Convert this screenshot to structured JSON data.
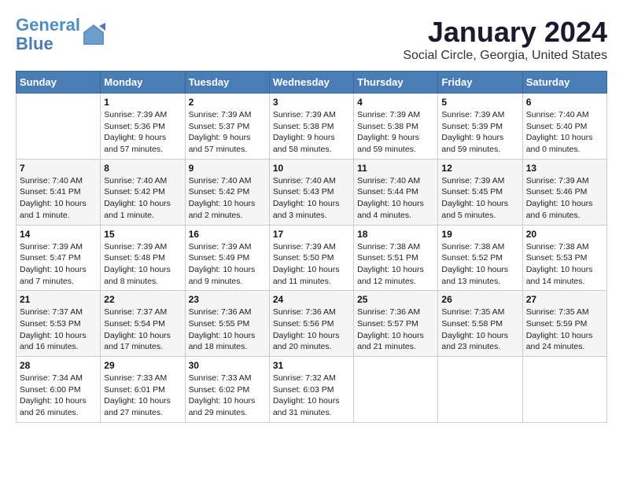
{
  "header": {
    "logo_line1": "General",
    "logo_line2": "Blue",
    "month_title": "January 2024",
    "location": "Social Circle, Georgia, United States"
  },
  "weekdays": [
    "Sunday",
    "Monday",
    "Tuesday",
    "Wednesday",
    "Thursday",
    "Friday",
    "Saturday"
  ],
  "weeks": [
    [
      {
        "day": "",
        "info": ""
      },
      {
        "day": "1",
        "info": "Sunrise: 7:39 AM\nSunset: 5:36 PM\nDaylight: 9 hours\nand 57 minutes."
      },
      {
        "day": "2",
        "info": "Sunrise: 7:39 AM\nSunset: 5:37 PM\nDaylight: 9 hours\nand 57 minutes."
      },
      {
        "day": "3",
        "info": "Sunrise: 7:39 AM\nSunset: 5:38 PM\nDaylight: 9 hours\nand 58 minutes."
      },
      {
        "day": "4",
        "info": "Sunrise: 7:39 AM\nSunset: 5:38 PM\nDaylight: 9 hours\nand 59 minutes."
      },
      {
        "day": "5",
        "info": "Sunrise: 7:39 AM\nSunset: 5:39 PM\nDaylight: 9 hours\nand 59 minutes."
      },
      {
        "day": "6",
        "info": "Sunrise: 7:40 AM\nSunset: 5:40 PM\nDaylight: 10 hours\nand 0 minutes."
      }
    ],
    [
      {
        "day": "7",
        "info": "Sunrise: 7:40 AM\nSunset: 5:41 PM\nDaylight: 10 hours\nand 1 minute."
      },
      {
        "day": "8",
        "info": "Sunrise: 7:40 AM\nSunset: 5:42 PM\nDaylight: 10 hours\nand 1 minute."
      },
      {
        "day": "9",
        "info": "Sunrise: 7:40 AM\nSunset: 5:42 PM\nDaylight: 10 hours\nand 2 minutes."
      },
      {
        "day": "10",
        "info": "Sunrise: 7:40 AM\nSunset: 5:43 PM\nDaylight: 10 hours\nand 3 minutes."
      },
      {
        "day": "11",
        "info": "Sunrise: 7:40 AM\nSunset: 5:44 PM\nDaylight: 10 hours\nand 4 minutes."
      },
      {
        "day": "12",
        "info": "Sunrise: 7:39 AM\nSunset: 5:45 PM\nDaylight: 10 hours\nand 5 minutes."
      },
      {
        "day": "13",
        "info": "Sunrise: 7:39 AM\nSunset: 5:46 PM\nDaylight: 10 hours\nand 6 minutes."
      }
    ],
    [
      {
        "day": "14",
        "info": "Sunrise: 7:39 AM\nSunset: 5:47 PM\nDaylight: 10 hours\nand 7 minutes."
      },
      {
        "day": "15",
        "info": "Sunrise: 7:39 AM\nSunset: 5:48 PM\nDaylight: 10 hours\nand 8 minutes."
      },
      {
        "day": "16",
        "info": "Sunrise: 7:39 AM\nSunset: 5:49 PM\nDaylight: 10 hours\nand 9 minutes."
      },
      {
        "day": "17",
        "info": "Sunrise: 7:39 AM\nSunset: 5:50 PM\nDaylight: 10 hours\nand 11 minutes."
      },
      {
        "day": "18",
        "info": "Sunrise: 7:38 AM\nSunset: 5:51 PM\nDaylight: 10 hours\nand 12 minutes."
      },
      {
        "day": "19",
        "info": "Sunrise: 7:38 AM\nSunset: 5:52 PM\nDaylight: 10 hours\nand 13 minutes."
      },
      {
        "day": "20",
        "info": "Sunrise: 7:38 AM\nSunset: 5:53 PM\nDaylight: 10 hours\nand 14 minutes."
      }
    ],
    [
      {
        "day": "21",
        "info": "Sunrise: 7:37 AM\nSunset: 5:53 PM\nDaylight: 10 hours\nand 16 minutes."
      },
      {
        "day": "22",
        "info": "Sunrise: 7:37 AM\nSunset: 5:54 PM\nDaylight: 10 hours\nand 17 minutes."
      },
      {
        "day": "23",
        "info": "Sunrise: 7:36 AM\nSunset: 5:55 PM\nDaylight: 10 hours\nand 18 minutes."
      },
      {
        "day": "24",
        "info": "Sunrise: 7:36 AM\nSunset: 5:56 PM\nDaylight: 10 hours\nand 20 minutes."
      },
      {
        "day": "25",
        "info": "Sunrise: 7:36 AM\nSunset: 5:57 PM\nDaylight: 10 hours\nand 21 minutes."
      },
      {
        "day": "26",
        "info": "Sunrise: 7:35 AM\nSunset: 5:58 PM\nDaylight: 10 hours\nand 23 minutes."
      },
      {
        "day": "27",
        "info": "Sunrise: 7:35 AM\nSunset: 5:59 PM\nDaylight: 10 hours\nand 24 minutes."
      }
    ],
    [
      {
        "day": "28",
        "info": "Sunrise: 7:34 AM\nSunset: 6:00 PM\nDaylight: 10 hours\nand 26 minutes."
      },
      {
        "day": "29",
        "info": "Sunrise: 7:33 AM\nSunset: 6:01 PM\nDaylight: 10 hours\nand 27 minutes."
      },
      {
        "day": "30",
        "info": "Sunrise: 7:33 AM\nSunset: 6:02 PM\nDaylight: 10 hours\nand 29 minutes."
      },
      {
        "day": "31",
        "info": "Sunrise: 7:32 AM\nSunset: 6:03 PM\nDaylight: 10 hours\nand 31 minutes."
      },
      {
        "day": "",
        "info": ""
      },
      {
        "day": "",
        "info": ""
      },
      {
        "day": "",
        "info": ""
      }
    ]
  ]
}
